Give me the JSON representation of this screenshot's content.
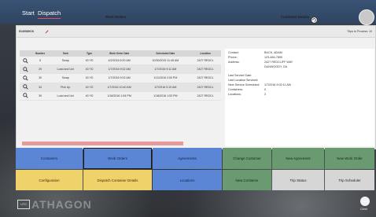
{
  "menubar": {
    "start_label": "Start",
    "dispatch_label": "Dispatch"
  },
  "header": {
    "unit": "5140080CK",
    "trips": "Trips In Process: 10"
  },
  "work_orders": {
    "title": "Work Orders",
    "columns": [
      "Number",
      "Task",
      "Type",
      "Work Order Date",
      "Scheduled Date",
      "Location"
    ],
    "rows": [
      [
        "5",
        "Swap",
        "40 YD",
        "4/2/2015 6:20 AM",
        "10/30/2015 11:45 AM",
        "2427 REDCL"
      ],
      [
        "29",
        "Load and Unl",
        "40 YD",
        "1/7/2016 9:02 AM",
        "1/7/2016 9:11 AM",
        "2427 REDCL"
      ],
      [
        "30",
        "Swap",
        "40 YD",
        "1/7/2016 9:02 AM",
        "1/11/2016 2:00 PM",
        "2427 REDCL"
      ],
      [
        "34",
        "Pick Up",
        "40 YD",
        "1/7/2016 10:40 AM",
        "1/7/2016 9:19 AM",
        "2427 REDCL"
      ],
      [
        "39",
        "Load and Unl",
        "40 YD",
        "1/18/2016 1:54 PM",
        "1/18/2016 1:53 PM",
        "2427 REDCL"
      ]
    ]
  },
  "customer_details": {
    "title": "Customer Details",
    "fields": [
      {
        "label": "Contact:",
        "value": "BUCK, ADAM"
      },
      {
        "label": "Phone:",
        "value": "123-456-7890"
      },
      {
        "label": "Address:",
        "value": "2427 REDCLIFF WAY"
      },
      {
        "label": "",
        "value": "DUNWOODY, GA"
      },
      {
        "label": "Last Service Date:",
        "value": ""
      },
      {
        "label": "Last Location Serviced:",
        "value": ""
      },
      {
        "label": "Next Service Scheduled:",
        "value": "1/7/2016 9:02:11 AM"
      },
      {
        "label": "Containers:",
        "value": "0"
      },
      {
        "label": "Locations:",
        "value": "3"
      }
    ]
  },
  "tiles": {
    "containers": "Containers",
    "work_orders": "Work Orders",
    "agreements": "Agreements",
    "change_customer": "Change Customer",
    "new_agreement": "New Agreement",
    "new_work_order": "New Work Order",
    "configuration": "Configuration",
    "dispatch_container_details": "Dispatch Container Details",
    "locations": "Locations",
    "new_container": "New Container",
    "trip_status": "Trip Status",
    "trip_scheduler": "Trip Scheduler"
  },
  "footer": {
    "logo": "UTO",
    "brand": "ATHAGON",
    "close_label": "Close"
  },
  "colors": {
    "menubar": "#2f4461",
    "accent_underline": "#e84a6a",
    "tile_blue": "#5b86d6",
    "tile_yellow": "#efd36a",
    "tile_green": "#6a9a6f",
    "tile_light": "#d6d6d6",
    "progress": "#e69a9a"
  },
  "icons": {
    "row_search": "magnifier-icon",
    "edit": "pencil-icon",
    "refresh": "refresh-icon"
  },
  "state": {
    "selected_tile": "work_orders"
  }
}
